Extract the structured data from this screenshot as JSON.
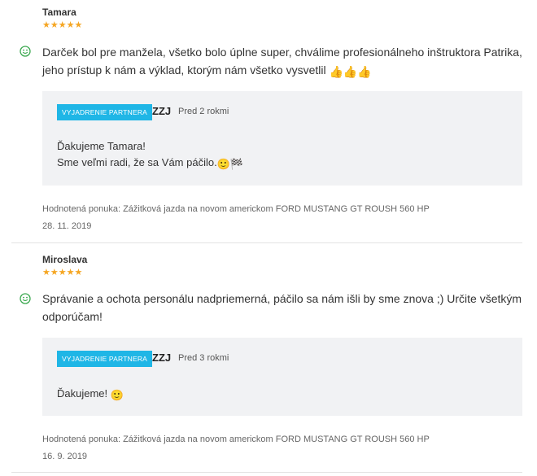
{
  "reviews": [
    {
      "author": "Tamara",
      "stars": "★★★★★",
      "rating": 5,
      "text": "Darček bol pre manžela, všetko bolo úplne super, chválime profesionálneho inštruktora Patrika, jeho prístup k nám a výklad, ktorým nám všetko vysvetlil",
      "text_emoji": "👍👍👍",
      "reply": {
        "badge": "VYJADRENIE PARTNERA",
        "partner": "ZZJ",
        "time": "Pred 2 rokmi",
        "line1": "Ďakujeme Tamara!",
        "line2": "Sme veľmi radi, že sa Vám páčilo.",
        "line2_emoji": "🙂🏁"
      },
      "offer": "Hodnotená ponuka: Zážitková jazda na novom americkom FORD MUSTANG GT ROUSH 560 HP",
      "date": "28. 11. 2019"
    },
    {
      "author": "Miroslava",
      "stars": "★★★★★",
      "rating": 5,
      "text": "Správanie a ochota personálu nadpriemerná, páčilo sa nám išli by sme znova ;) Určite všetkým odporúčam!",
      "reply": {
        "badge": "VYJADRENIE PARTNERA",
        "partner": "ZZJ",
        "time": "Pred 3 rokmi",
        "line1": "Ďakujeme!",
        "line1_emoji": "🙂"
      },
      "offer": "Hodnotená ponuka: Zážitková jazda na novom americkom FORD MUSTANG GT ROUSH 560 HP",
      "date": "16. 9. 2019"
    }
  ],
  "colors": {
    "star": "#f5a623",
    "badge": "#1fb6e6",
    "smile": "#3aa84f",
    "reply_bg": "#f1f2f4"
  }
}
